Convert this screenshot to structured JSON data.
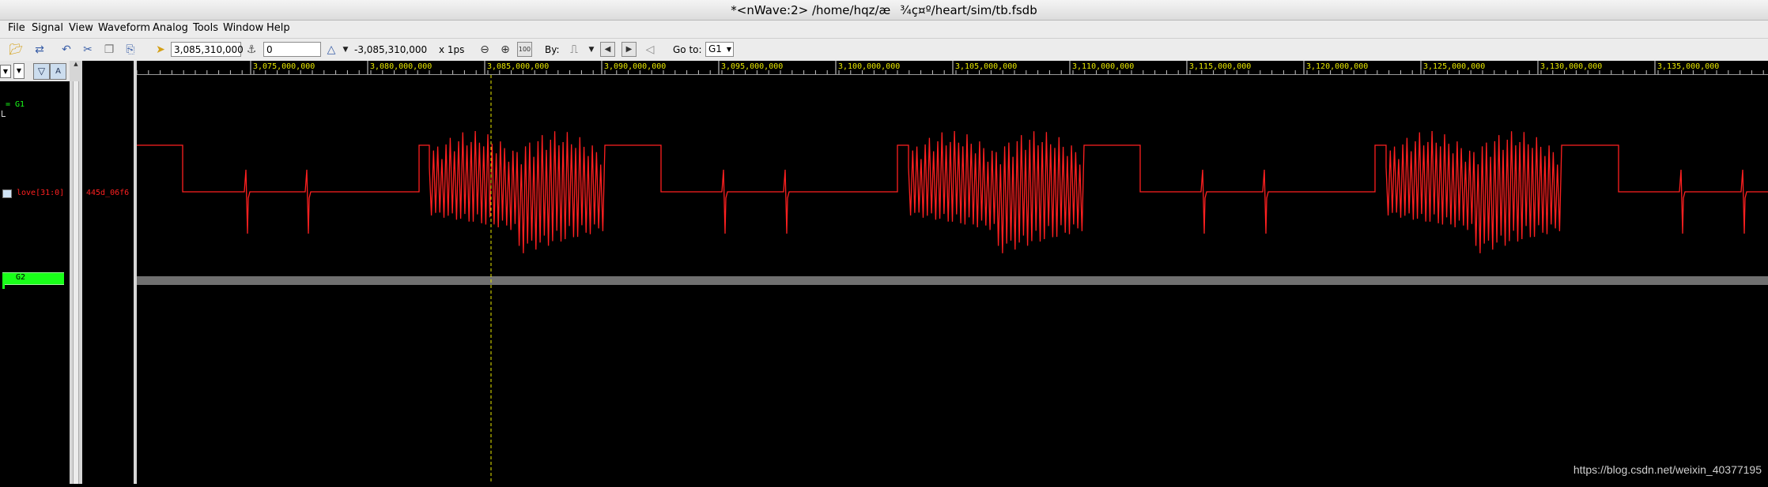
{
  "window": {
    "title": "*<nWave:2> /home/hqz/æ¾ç¤º/heart/sim/tb.fsdb"
  },
  "menu": {
    "items": [
      {
        "label": "File"
      },
      {
        "label": "Signal"
      },
      {
        "label": "View"
      },
      {
        "label": "Waveform"
      },
      {
        "label": "Analog"
      },
      {
        "label": "Tools"
      },
      {
        "label": "Window"
      },
      {
        "label": "Help"
      }
    ]
  },
  "toolbar": {
    "cursor_time": "3,085,310,000",
    "marker_time": "0",
    "delta_time": "-3,085,310,000",
    "time_unit": "x 1ps",
    "by_label": "By:",
    "goto_label": "Go to:",
    "goto_value": "G1"
  },
  "signals": {
    "group1": "= G1",
    "signal_name": "love[31:0]",
    "signal_value": "445d_06f6",
    "group2": "G2"
  },
  "ruler": {
    "labels": [
      "3,075,000,000",
      "3,080,000,000",
      "3,085,000,000",
      "3,090,000,000",
      "3,095,000,000",
      "3,100,000,000",
      "3,105,000,000",
      "3,110,000,000",
      "3,115,000,000",
      "3,120,000,000",
      "3,125,000,000",
      "3,130,000,000",
      "3,135,000,000"
    ]
  },
  "colors": {
    "waveform": "#ff2020",
    "ruler_text": "#e8e800",
    "cursor": "#e8e800",
    "group_highlight": "#19ff19"
  },
  "watermark": "https://blog.csdn.net/weixin_40377195"
}
